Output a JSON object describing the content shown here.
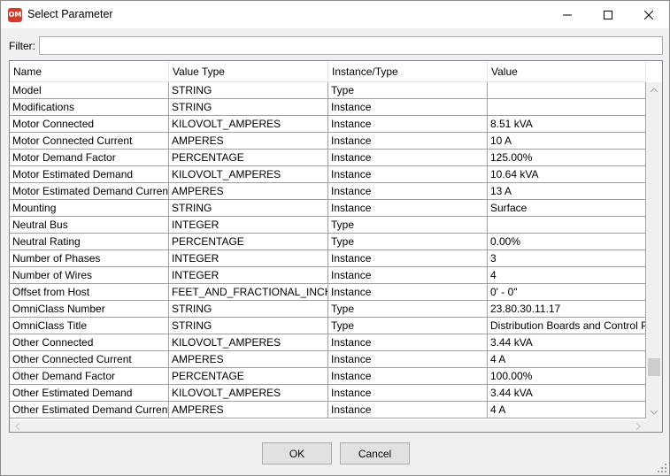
{
  "window": {
    "title": "Select Parameter",
    "app_icon_text": "OM"
  },
  "filter": {
    "label": "Filter:",
    "value": "",
    "placeholder": ""
  },
  "grid": {
    "columns": [
      "Name",
      "Value Type",
      "Instance/Type",
      "Value"
    ],
    "rows": [
      [
        "Model",
        "STRING",
        "Type",
        ""
      ],
      [
        "Modifications",
        "STRING",
        "Instance",
        ""
      ],
      [
        "Motor Connected",
        "KILOVOLT_AMPERES",
        "Instance",
        "8.51 kVA"
      ],
      [
        "Motor Connected Current",
        "AMPERES",
        "Instance",
        "10 A"
      ],
      [
        "Motor Demand Factor",
        "PERCENTAGE",
        "Instance",
        "125.00%"
      ],
      [
        "Motor Estimated Demand",
        "KILOVOLT_AMPERES",
        "Instance",
        "10.64 kVA"
      ],
      [
        "Motor Estimated Demand Current",
        "AMPERES",
        "Instance",
        "13 A"
      ],
      [
        "Mounting",
        "STRING",
        "Instance",
        "Surface"
      ],
      [
        "Neutral Bus",
        "INTEGER",
        "Type",
        ""
      ],
      [
        "Neutral Rating",
        "PERCENTAGE",
        "Type",
        "0.00%"
      ],
      [
        "Number of Phases",
        "INTEGER",
        "Instance",
        "3"
      ],
      [
        "Number of Wires",
        "INTEGER",
        "Instance",
        "4"
      ],
      [
        "Offset from Host",
        "FEET_AND_FRACTIONAL_INCHES",
        "Instance",
        "0' - 0\""
      ],
      [
        "OmniClass Number",
        "STRING",
        "Type",
        "23.80.30.11.17"
      ],
      [
        "OmniClass Title",
        "STRING",
        "Type",
        "Distribution Boards and Control Panels"
      ],
      [
        "Other Connected",
        "KILOVOLT_AMPERES",
        "Instance",
        "3.44 kVA"
      ],
      [
        "Other Connected Current",
        "AMPERES",
        "Instance",
        "4 A"
      ],
      [
        "Other Demand Factor",
        "PERCENTAGE",
        "Instance",
        "100.00%"
      ],
      [
        "Other Estimated Demand",
        "KILOVOLT_AMPERES",
        "Instance",
        "3.44 kVA"
      ],
      [
        "Other Estimated Demand Current",
        "AMPERES",
        "Instance",
        "4 A"
      ]
    ]
  },
  "buttons": {
    "ok": "OK",
    "cancel": "Cancel"
  }
}
